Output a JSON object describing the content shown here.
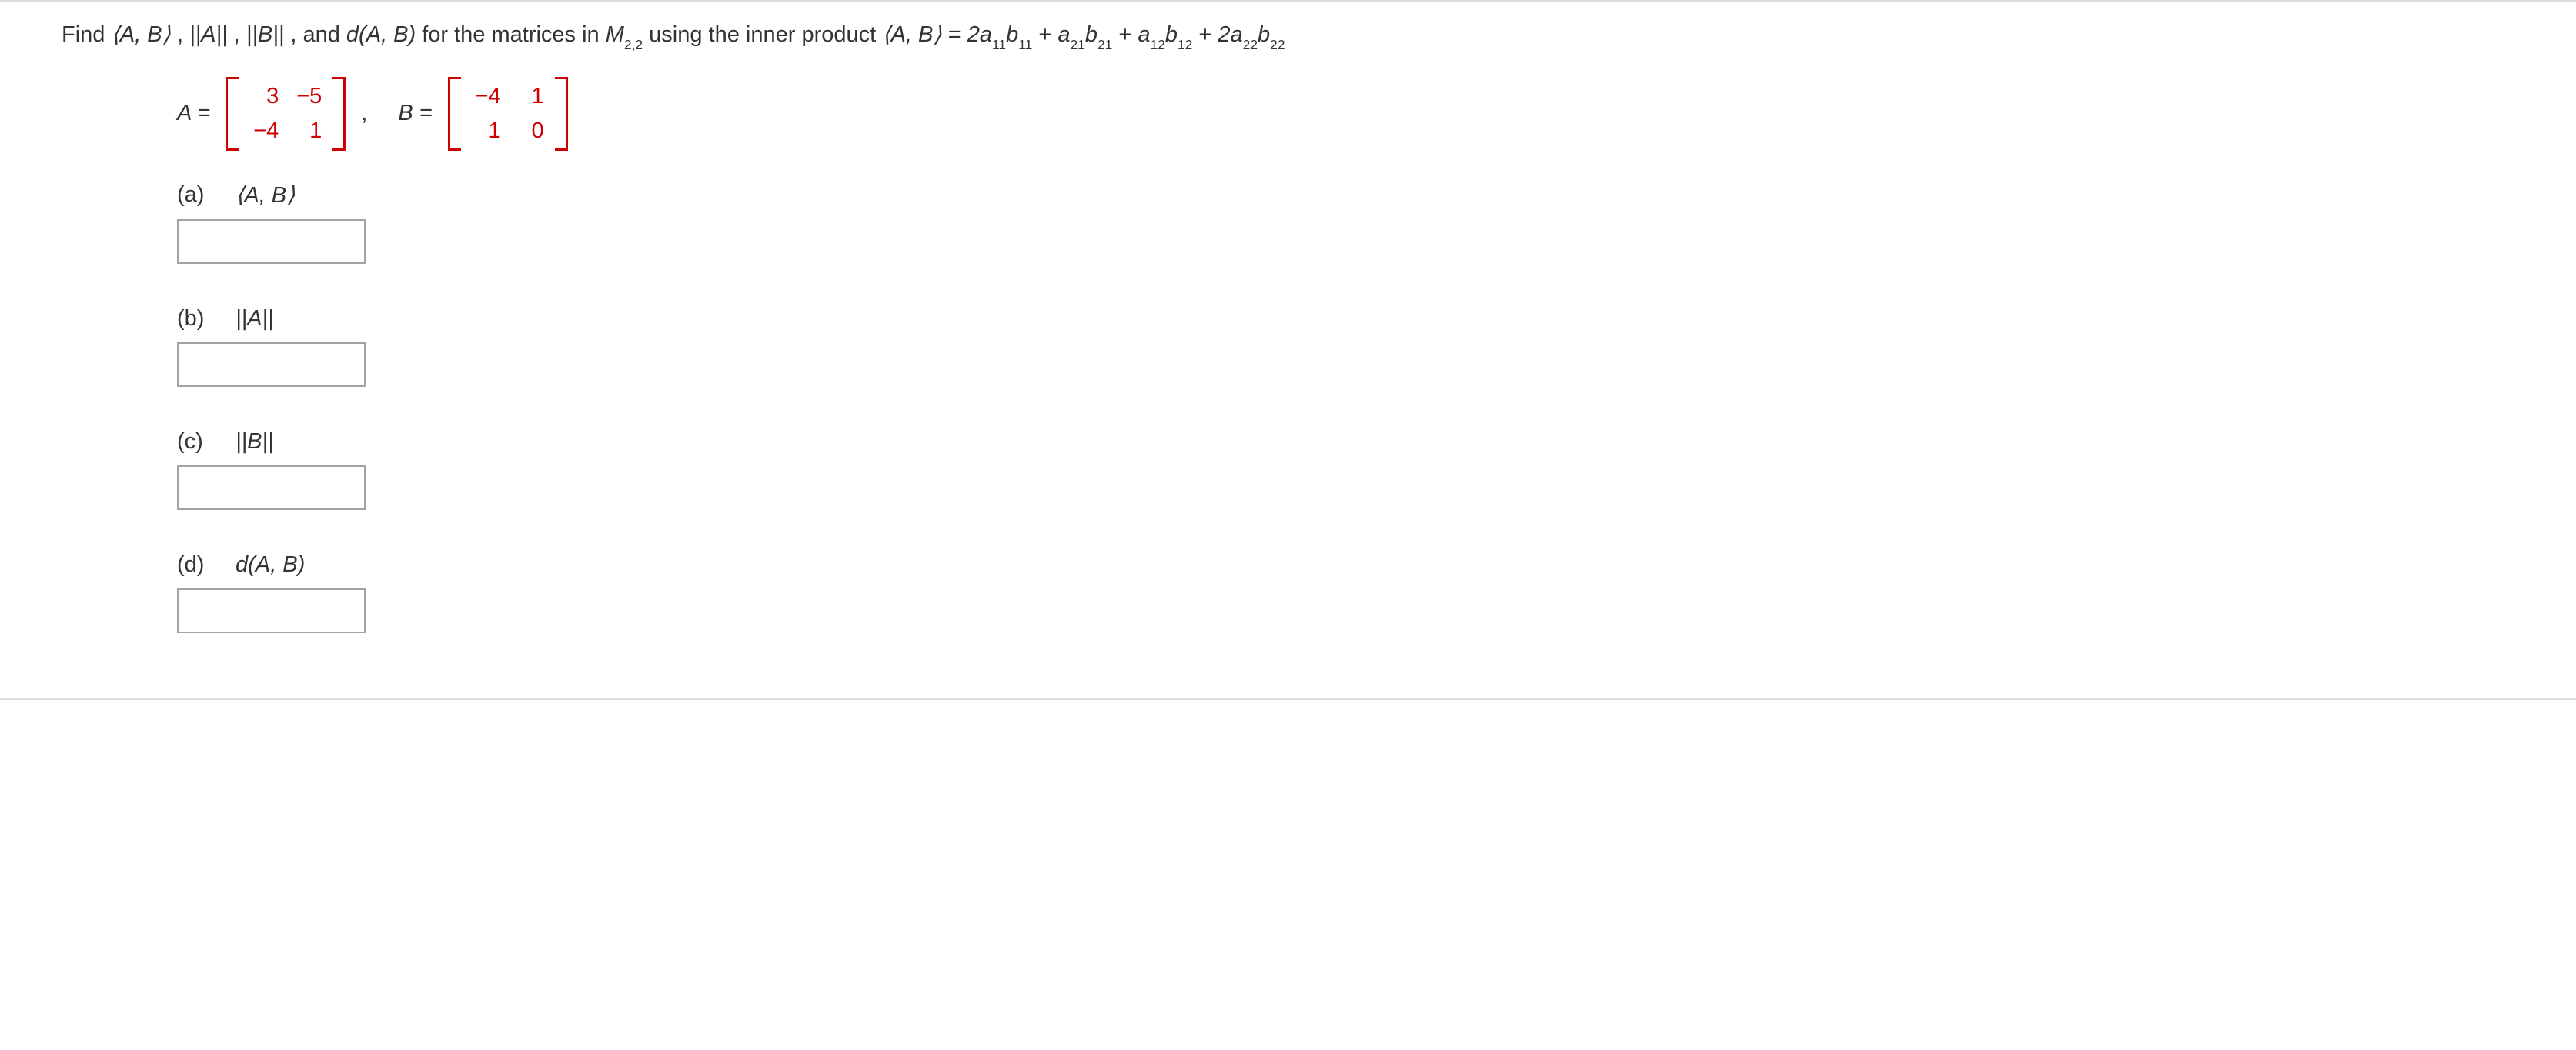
{
  "question": {
    "lead": "Find ",
    "ab": "⟨A, B⟩",
    "sepcomma": ", ",
    "normA": "||A||",
    "sep2": ", ",
    "normB": "||B||",
    "sep3": ", and ",
    "dfunc_pre": "d",
    "dfunc_args": "(A, B) ",
    "mid1": " for the matrices in ",
    "space_M": "M",
    "space_sub": "2,2",
    "mid2": " using the inner product ",
    "def_lhs": "⟨A, B⟩",
    "def_eq": " = ",
    "t1c": "2a",
    "t1s1": "11",
    "t1b": "b",
    "t1s2": "11",
    "plus1": " + ",
    "t2c": "a",
    "t2s1": "21",
    "t2b": "b",
    "t2s2": "21",
    "plus2": " + ",
    "t3c": "a",
    "t3s1": "12",
    "t3b": "b",
    "t3s2": "12",
    "plus3": " + ",
    "t4c": "2a",
    "t4s1": "22",
    "t4b": "b",
    "t4s2": "22"
  },
  "matrices": {
    "A_label": "A =",
    "A": {
      "r1c1": "3",
      "r1c2": "−5",
      "r2c1": "−4",
      "r2c2": "1"
    },
    "comma": ",",
    "B_label": "B =",
    "B": {
      "r1c1": "−4",
      "r1c2": "1",
      "r2c1": "1",
      "r2c2": "0"
    }
  },
  "parts": {
    "a": {
      "label": "(a)",
      "text": "⟨A, B⟩"
    },
    "b": {
      "label": "(b)",
      "text": "||A||"
    },
    "c": {
      "label": "(c)",
      "text": "||B||"
    },
    "d": {
      "label": "(d)",
      "text_pre": "d",
      "text_args": "(A, B)"
    }
  },
  "answers": {
    "a": "",
    "b": "",
    "c": "",
    "d": ""
  },
  "colors": {
    "matrix_red": "#cf0000",
    "border_gray": "#dcdcdc",
    "box_border": "#a3a3a3"
  }
}
